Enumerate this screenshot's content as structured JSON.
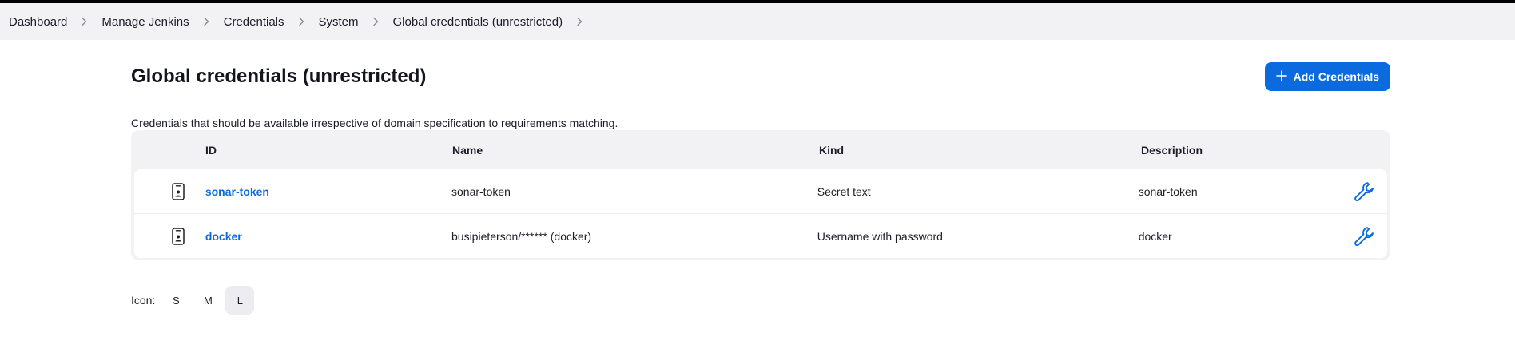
{
  "breadcrumbs": [
    {
      "label": "Dashboard"
    },
    {
      "label": "Manage Jenkins"
    },
    {
      "label": "Credentials"
    },
    {
      "label": "System"
    },
    {
      "label": "Global credentials (unrestricted)"
    }
  ],
  "page": {
    "title": "Global credentials (unrestricted)",
    "description": "Credentials that should be available irrespective of domain specification to requirements matching.",
    "add_button_label": "Add Credentials",
    "add_button_icon": "plus-icon"
  },
  "table": {
    "headers": {
      "id": "ID",
      "name": "Name",
      "kind": "Kind",
      "description": "Description"
    },
    "rows": [
      {
        "icon": "credential-card-icon",
        "id": "sonar-token",
        "name": "sonar-token",
        "kind": "Secret text",
        "description": "sonar-token",
        "action_icon": "wrench-icon"
      },
      {
        "icon": "credential-card-icon",
        "id": "docker",
        "name": "busipieterson/****** (docker)",
        "kind": "Username with password",
        "description": "docker",
        "action_icon": "wrench-icon"
      }
    ]
  },
  "icon_size": {
    "label": "Icon:",
    "options": [
      "S",
      "M",
      "L"
    ],
    "selected": "L"
  },
  "colors": {
    "accent": "#0b6bde",
    "breadcrumb_bg": "#f2f2f5",
    "table_bg": "#f2f2f5",
    "top_border": "#000000"
  }
}
